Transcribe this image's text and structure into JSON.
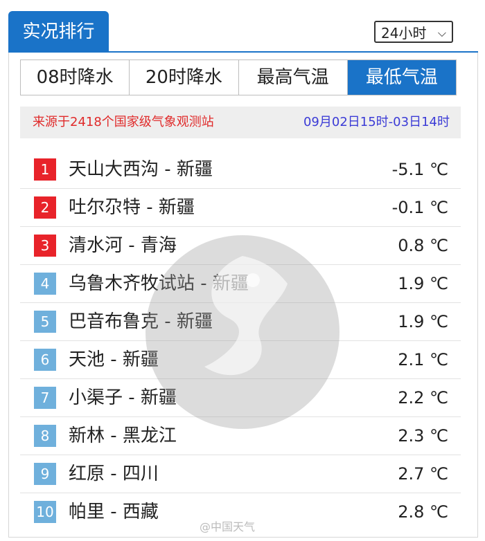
{
  "header": {
    "title": "实况排行",
    "period_select": "24小时"
  },
  "tabs": [
    {
      "label": "08时降水",
      "active": false
    },
    {
      "label": "20时降水",
      "active": false
    },
    {
      "label": "最高气温",
      "active": false
    },
    {
      "label": "最低气温",
      "active": true
    }
  ],
  "source": {
    "left_text": "来源于2418个国家级气象观测站",
    "right_text": "09月02日15时-03日14时"
  },
  "rows": [
    {
      "rank": "1",
      "name": "天山大西沟 - 新疆",
      "value": "-5.1 ℃",
      "color": "#e8232a"
    },
    {
      "rank": "2",
      "name": "吐尔尕特 - 新疆",
      "value": "-0.1 ℃",
      "color": "#e8232a"
    },
    {
      "rank": "3",
      "name": "清水河 - 青海",
      "value": "0.8 ℃",
      "color": "#e8232a"
    },
    {
      "rank": "4",
      "name": "乌鲁木齐牧试站 - 新疆",
      "value": "1.9 ℃",
      "color": "#6fb0dc"
    },
    {
      "rank": "5",
      "name": "巴音布鲁克 - 新疆",
      "value": "1.9 ℃",
      "color": "#6fb0dc"
    },
    {
      "rank": "6",
      "name": "天池 - 新疆",
      "value": "2.1 ℃",
      "color": "#6fb0dc"
    },
    {
      "rank": "7",
      "name": "小渠子 - 新疆",
      "value": "2.2 ℃",
      "color": "#6fb0dc"
    },
    {
      "rank": "8",
      "name": "新林 - 黑龙江",
      "value": "2.3 ℃",
      "color": "#6fb0dc"
    },
    {
      "rank": "9",
      "name": "红原 - 四川",
      "value": "2.7 ℃",
      "color": "#6fb0dc"
    },
    {
      "rank": "10",
      "name": "帕里 - 西藏",
      "value": "2.8 ℃",
      "color": "#6fb0dc"
    }
  ],
  "watermark": {
    "text": "@中国天气"
  },
  "colors": {
    "accent": "#1a73c8",
    "top_rank": "#e8232a",
    "other_rank": "#6fb0dc"
  }
}
